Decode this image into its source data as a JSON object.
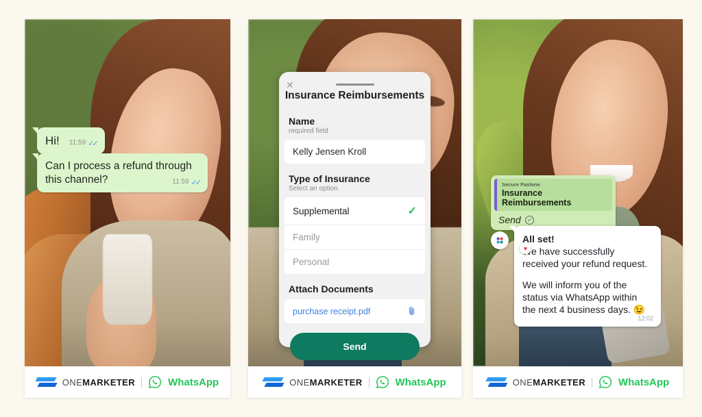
{
  "page": {
    "background": "#FBF9EF"
  },
  "brand": {
    "logo_icon": "onemarketer-arrows-icon",
    "name_light": "ONE",
    "name_bold": "MARKETER",
    "divider": "|",
    "whatsapp_icon": "whatsapp-icon",
    "whatsapp_label": "WhatsApp",
    "colors": {
      "blue_light": "#2F9BEF",
      "blue_dark": "#1366D6",
      "whatsapp_green": "#25C65A"
    }
  },
  "panel1": {
    "name": "chat-conversation-panel",
    "messages": [
      {
        "text": "Hi!",
        "time": "11:59",
        "ticks": "read-ticks-icon"
      },
      {
        "text": "Can I process a refund through this channel?",
        "time": "11:59",
        "ticks": "read-ticks-icon"
      }
    ],
    "bubble_color": "#DDF5CC"
  },
  "panel2": {
    "name": "insurance-form-panel",
    "form": {
      "close_icon": "close-icon",
      "grip": "drag-handle-icon",
      "title": "Insurance Reimbursements",
      "name_field": {
        "label": "Name",
        "hint": "required field",
        "value": "Kelly Jensen Kroll"
      },
      "insurance_field": {
        "label": "Type of Insurance",
        "hint": "Select an option",
        "options": [
          {
            "label": "Supplemental",
            "selected": true,
            "check_icon": "check-icon"
          },
          {
            "label": "Family",
            "selected": false
          },
          {
            "label": "Personal",
            "selected": false
          }
        ]
      },
      "attach_field": {
        "label": "Attach Documents",
        "file_name": "purchase receipt.pdf",
        "attach_icon": "paperclip-icon"
      },
      "submit_label": "Send",
      "submit_color": "#0E7A5F"
    }
  },
  "panel3": {
    "name": "confirmation-panel",
    "quoted": {
      "source": "Secure Pastene",
      "title": "Insurance Reimbursements",
      "action": "Send",
      "status_icon": "check-circle-icon",
      "accent": "#7B5BD6"
    },
    "reply": {
      "lead": "All set!",
      "line1": "We have successfully received your refund request.",
      "line2": "We will inform you of the status via WhatsApp within the next 4 business days. 😉",
      "time": "12:02"
    },
    "reactions": {
      "avatar_icon": "group-avatar-icon",
      "heart_icon": "heart-reaction-icon"
    }
  }
}
